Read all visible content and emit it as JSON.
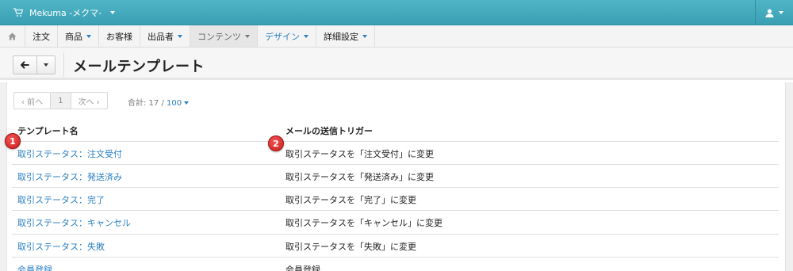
{
  "topbar": {
    "brand": "Mekuma -メクマ-",
    "brand_icon": "cart-icon",
    "user_icon": "user-icon",
    "color": "#43aabd"
  },
  "nav": {
    "home_icon": "home-icon",
    "items": [
      {
        "label": "注文",
        "dropdown": false
      },
      {
        "label": "商品",
        "dropdown": true
      },
      {
        "label": "お客様",
        "dropdown": false
      },
      {
        "label": "出品者",
        "dropdown": true
      },
      {
        "label": "コンテンツ",
        "dropdown": true,
        "active": true
      },
      {
        "label": "デザイン",
        "dropdown": true
      },
      {
        "label": "詳細設定",
        "dropdown": true
      }
    ]
  },
  "header": {
    "title": "メールテンプレート",
    "back_icon": "arrow-left-icon"
  },
  "pager": {
    "prev": "‹ 前へ",
    "page": "1",
    "next": "次へ ›",
    "total_label": "合計: 17 / ",
    "per_page": "100"
  },
  "table": {
    "headers": [
      "テンプレート名",
      "メールの送信トリガー"
    ],
    "rows": [
      {
        "name": "取引ステータス：注文受付",
        "trigger": "取引ステータスを「注文受付」に変更"
      },
      {
        "name": "取引ステータス：発送済み",
        "trigger": "取引ステータスを「発送済み」に変更"
      },
      {
        "name": "取引ステータス：完了",
        "trigger": "取引ステータスを「完了」に変更"
      },
      {
        "name": "取引ステータス：キャンセル",
        "trigger": "取引ステータスを「キャンセル」に変更"
      },
      {
        "name": "取引ステータス：失敗",
        "trigger": "取引ステータスを「失敗」に変更"
      },
      {
        "name": "会員登録",
        "trigger": "会員登録"
      }
    ]
  },
  "markers": [
    "1",
    "2"
  ]
}
